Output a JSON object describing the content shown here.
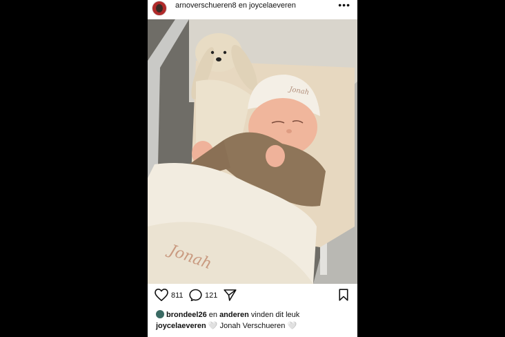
{
  "post": {
    "header": {
      "author_1": "arnoverschueren8",
      "connector": "en",
      "author_2": "joycelaeveren",
      "more_icon": "more-horizontal-icon"
    },
    "actions": {
      "like_count": "811",
      "comment_count": "121"
    },
    "likes": {
      "user": "brondeel26",
      "connector": "en",
      "others": "anderen",
      "suffix": "vinden dit leuk"
    },
    "caption": {
      "user": "joycelaeveren",
      "text": "Jonah Verschueren",
      "heart": "🤍"
    },
    "photo_text": {
      "hat_name": "Jonah",
      "blanket_name": "Jonah"
    }
  }
}
